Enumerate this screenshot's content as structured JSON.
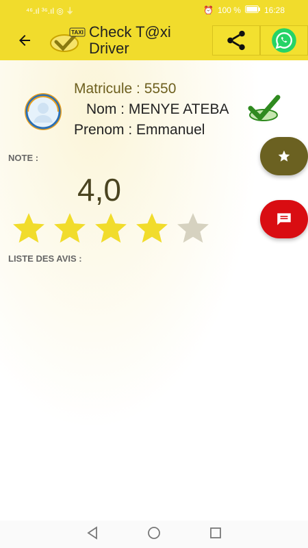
{
  "status_bar": {
    "left": "⁴⁶.ıl ³⁶.ıl ◎ ⏚",
    "battery": "100 %",
    "time": "16:28"
  },
  "header": {
    "title": "Check T@xi Driver",
    "logo_text": "TAXI"
  },
  "profile": {
    "matricule": "Matricule : 5550",
    "nom": "Nom : MENYE ATEBA",
    "prenom": "Prenom : Emmanuel"
  },
  "rating": {
    "label": "NOTE :",
    "value": "4,0",
    "stars_filled": 4,
    "stars_total": 5
  },
  "reviews": {
    "label": "LISTE DES AVIS :"
  },
  "colors": {
    "appbar": "#f1dc2c",
    "star_filled": "#f1dc2c",
    "star_empty": "#d6d2c0",
    "fab_rate": "#6b6121",
    "fab_comment": "#d90d12",
    "whatsapp": "#25d366"
  },
  "icons": {
    "back": "arrow-left-icon",
    "share": "share-icon",
    "whatsapp": "whatsapp-icon",
    "rate": "star-icon",
    "comment": "message-icon",
    "nav_back": "triangle-back-icon",
    "nav_home": "circle-home-icon",
    "nav_recents": "square-recents-icon"
  }
}
